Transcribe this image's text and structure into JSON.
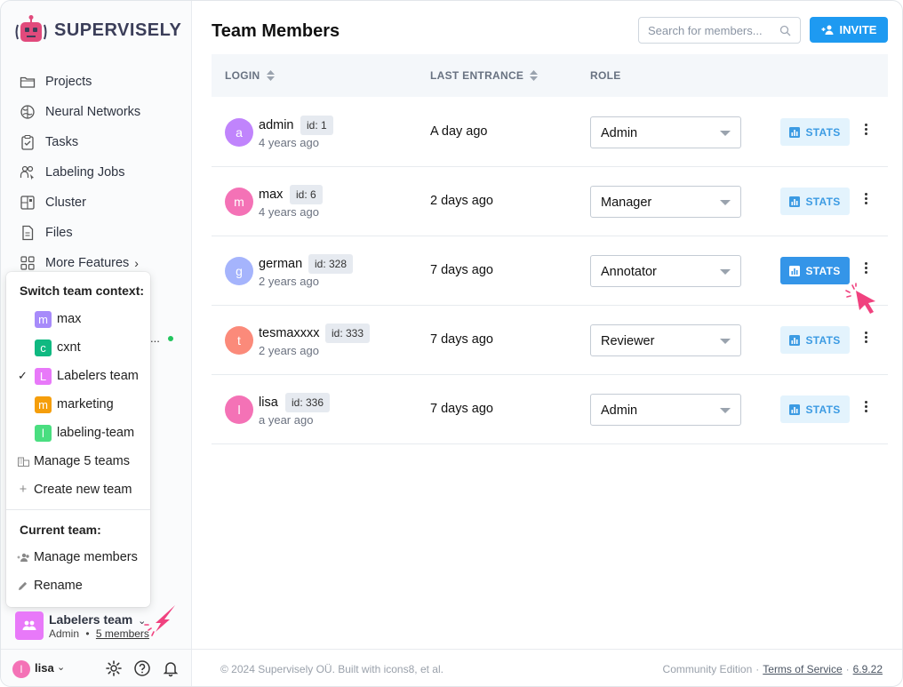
{
  "brand": {
    "name": "SUPERVISELY"
  },
  "nav": [
    {
      "label": "Projects",
      "icon": "folder-icon"
    },
    {
      "label": "Neural Networks",
      "icon": "brain-icon"
    },
    {
      "label": "Tasks",
      "icon": "clipboard-icon"
    },
    {
      "label": "Labeling Jobs",
      "icon": "labeling-jobs-icon"
    },
    {
      "label": "Cluster",
      "icon": "cluster-icon"
    },
    {
      "label": "Files",
      "icon": "file-icon"
    },
    {
      "label": "More Features",
      "icon": "grid-icon"
    }
  ],
  "nav_more_chevron": "›",
  "hidden_item_ellipsis": "...",
  "team_menu": {
    "switch_title": "Switch team context:",
    "teams": [
      {
        "initial": "m",
        "name": "max",
        "color": "#a78bfa",
        "selected": false
      },
      {
        "initial": "c",
        "name": "cxnt",
        "color": "#10b981",
        "selected": false
      },
      {
        "initial": "L",
        "name": "Labelers team",
        "color": "#e879f9",
        "selected": true
      },
      {
        "initial": "m",
        "name": "marketing",
        "color": "#f59e0b",
        "selected": false
      },
      {
        "initial": "l",
        "name": "labeling-team",
        "color": "#4ade80",
        "selected": false
      }
    ],
    "check_mark": "✓",
    "manage_teams": "Manage 5 teams",
    "create_team": "Create new team",
    "create_icon": "+",
    "current_title": "Current team:",
    "manage_members": "Manage members",
    "rename": "Rename"
  },
  "current_team": {
    "name": "Labelers team",
    "role": "Admin",
    "separator": "•",
    "members_link": "5 members",
    "chevron": "⌄"
  },
  "user": {
    "initial": "l",
    "name": "lisa",
    "chevron": "⌄"
  },
  "page": {
    "title": "Team Members",
    "search_placeholder": "Search for members...",
    "invite_label": "INVITE"
  },
  "table": {
    "columns": {
      "login": "LOGIN",
      "last_entrance": "LAST ENTRANCE",
      "role": "ROLE"
    },
    "stats_label": "STATS",
    "rows": [
      {
        "initial": "a",
        "color": "#c084fc",
        "login": "admin",
        "id": "id: 1",
        "ago": "4 years ago",
        "last": "A day ago",
        "role": "Admin",
        "active": false
      },
      {
        "initial": "m",
        "color": "#f472b6",
        "login": "max",
        "id": "id: 6",
        "ago": "4 years ago",
        "last": "2 days ago",
        "role": "Manager",
        "active": false
      },
      {
        "initial": "g",
        "color": "#a5b4fc",
        "login": "german",
        "id": "id: 328",
        "ago": "2 years ago",
        "last": "7 days ago",
        "role": "Annotator",
        "active": true
      },
      {
        "initial": "t",
        "color": "#fb8a7a",
        "login": "tesmaxxxx",
        "id": "id: 333",
        "ago": "2 years ago",
        "last": "7 days ago",
        "role": "Reviewer",
        "active": false
      },
      {
        "initial": "l",
        "color": "#f472b6",
        "login": "lisa",
        "id": "id: 336",
        "ago": "a year ago",
        "last": "7 days ago",
        "role": "Admin",
        "active": false
      }
    ]
  },
  "footer": {
    "copyright": "© 2024 Supervisely OÜ. Built with icons8, et al.",
    "edition": "Community Edition",
    "separator": "·",
    "terms": "Terms of Service",
    "version": "6.9.22"
  },
  "colors": {
    "accent": "#1e9af1",
    "stats_bg": "#e3f3fd",
    "stats_active": "#3495e8",
    "pointer_arrow": "#f0427f"
  }
}
